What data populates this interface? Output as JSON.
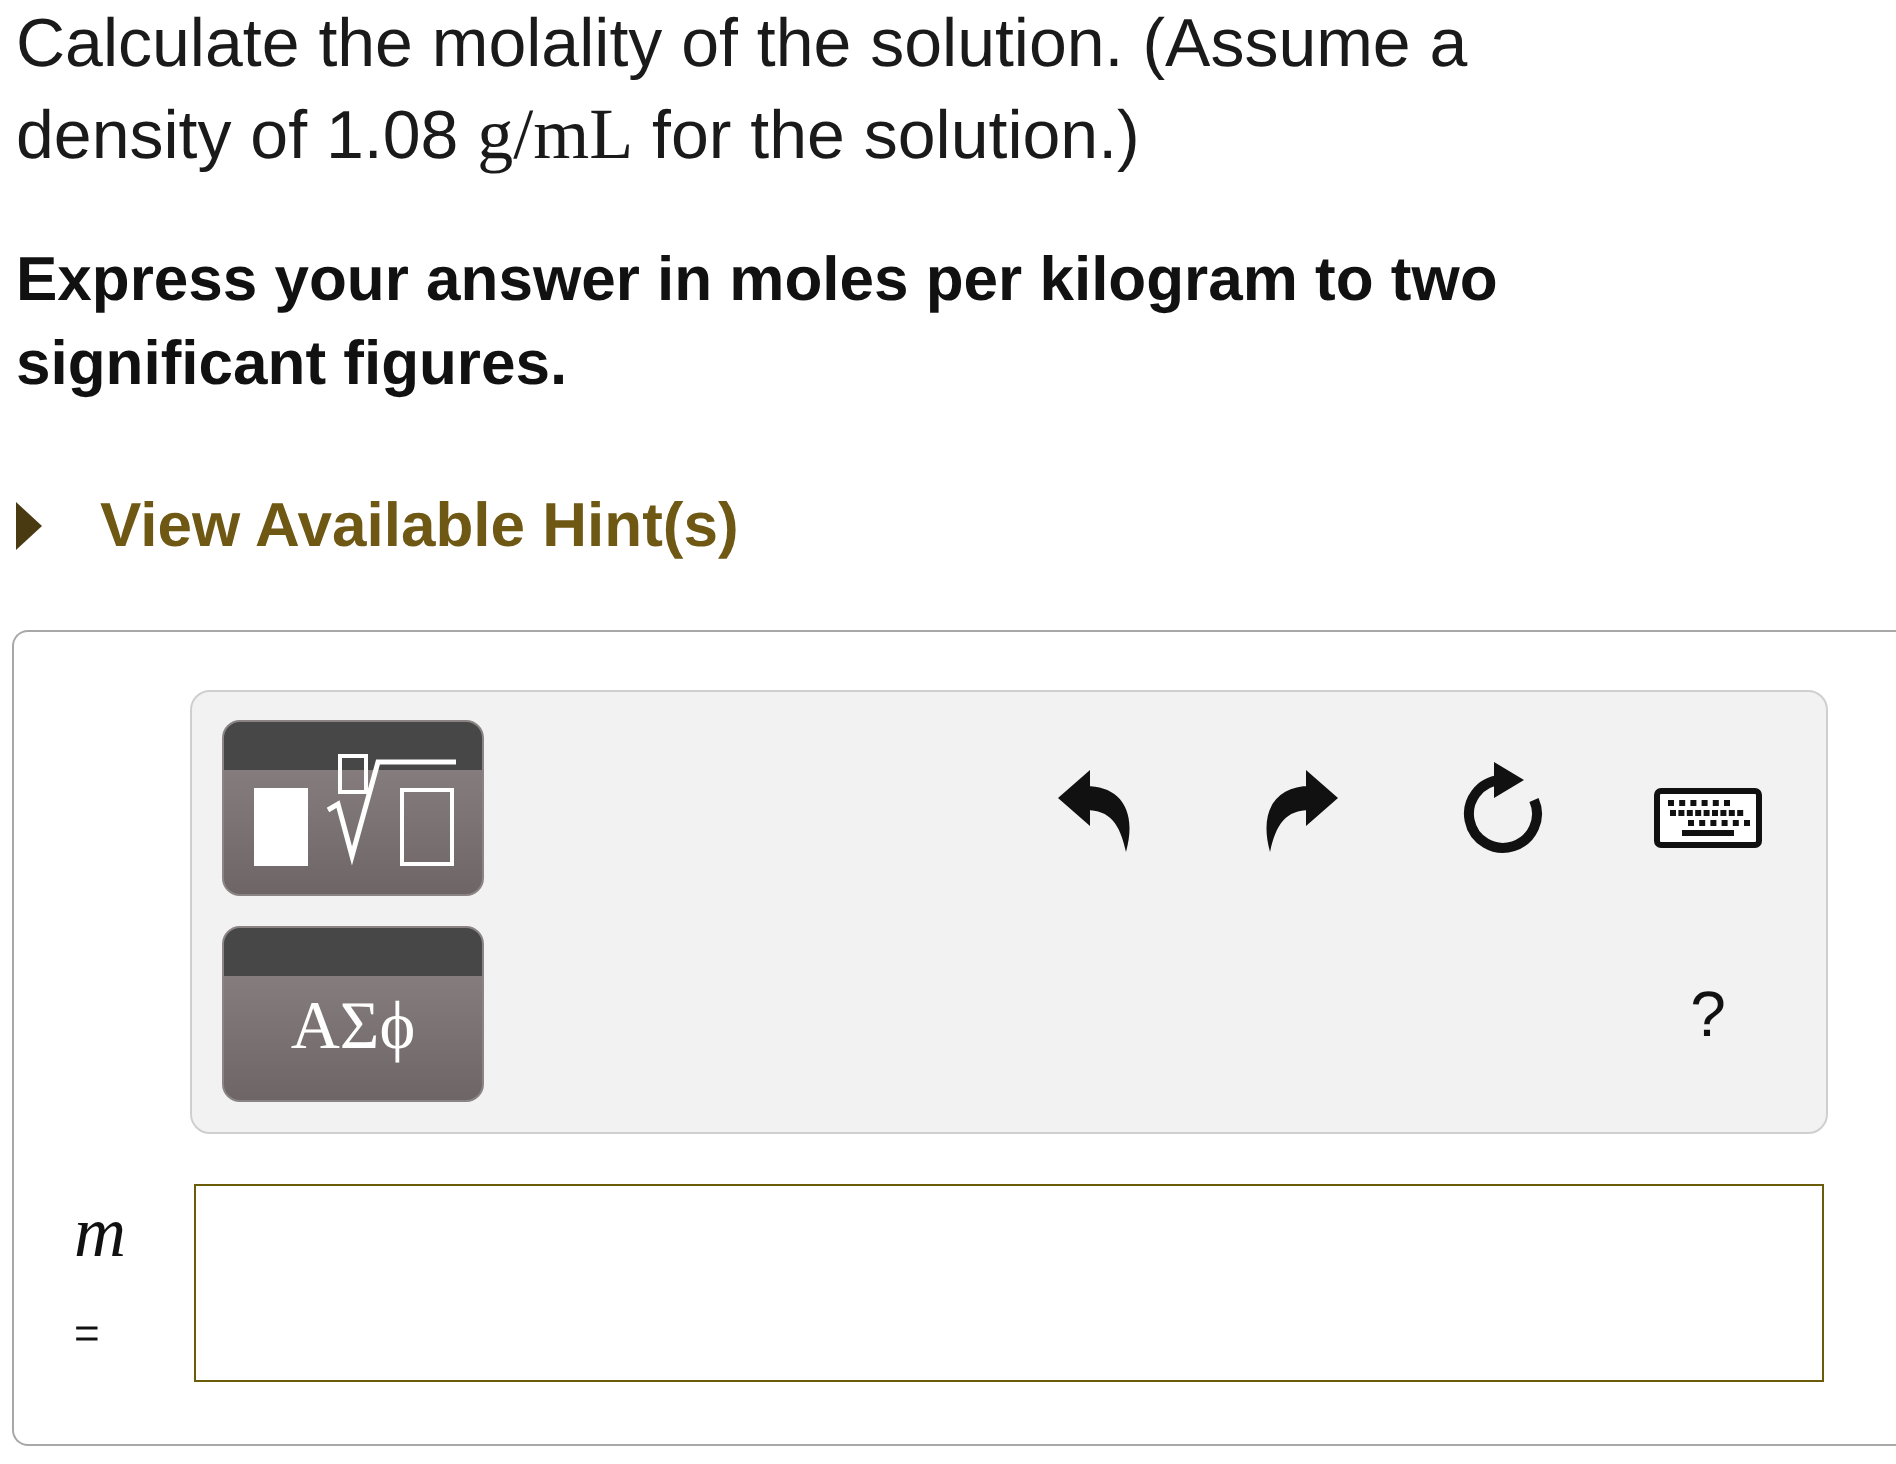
{
  "question": {
    "parts": [
      {
        "kind": "text",
        "text": "Calculate the molality of the solution. (Assume a density of 1.08 "
      },
      {
        "kind": "math",
        "text": "g/mL"
      },
      {
        "kind": "text",
        "text": " for the solution.)"
      }
    ]
  },
  "instruction": "Express your answer in moles per kilogram to two significant figures.",
  "hint": {
    "label": "View Available Hint(s)",
    "expanded": false
  },
  "toolbar": {
    "symbols_label": "ΑΣϕ",
    "help": "?"
  },
  "answer": {
    "variable": "m",
    "equals": "="
  }
}
